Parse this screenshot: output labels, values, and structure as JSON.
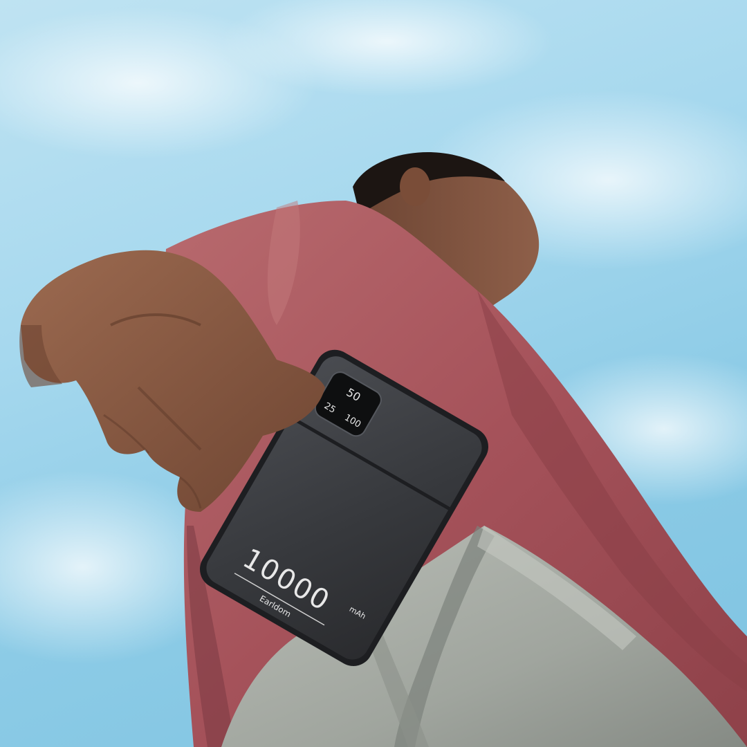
{
  "scene": {
    "description_free": true
  },
  "colors": {
    "sky_light": "#cdeaf6",
    "sky_mid": "#9fd3ea",
    "sky_deep": "#78c0df",
    "shirt": "#a8565d",
    "shirt_shadow": "#7e3c44",
    "shirt_light": "#c47a7c",
    "skin": "#8a5a43",
    "skin_shadow": "#5e3a2a",
    "hair": "#1c1512",
    "pants": "#a5aaa3",
    "pants_shadow": "#7c827c",
    "pants_light": "#c4c8c1",
    "bank_body": "#3a3c40",
    "bank_edge": "#1d1e21",
    "bank_text": "#e8e8e8"
  },
  "power_bank": {
    "capacity_number": "10000",
    "capacity_unit": "mAh",
    "brand": "Earldom",
    "display_top": "50",
    "display_left": "25",
    "display_right": "100"
  }
}
